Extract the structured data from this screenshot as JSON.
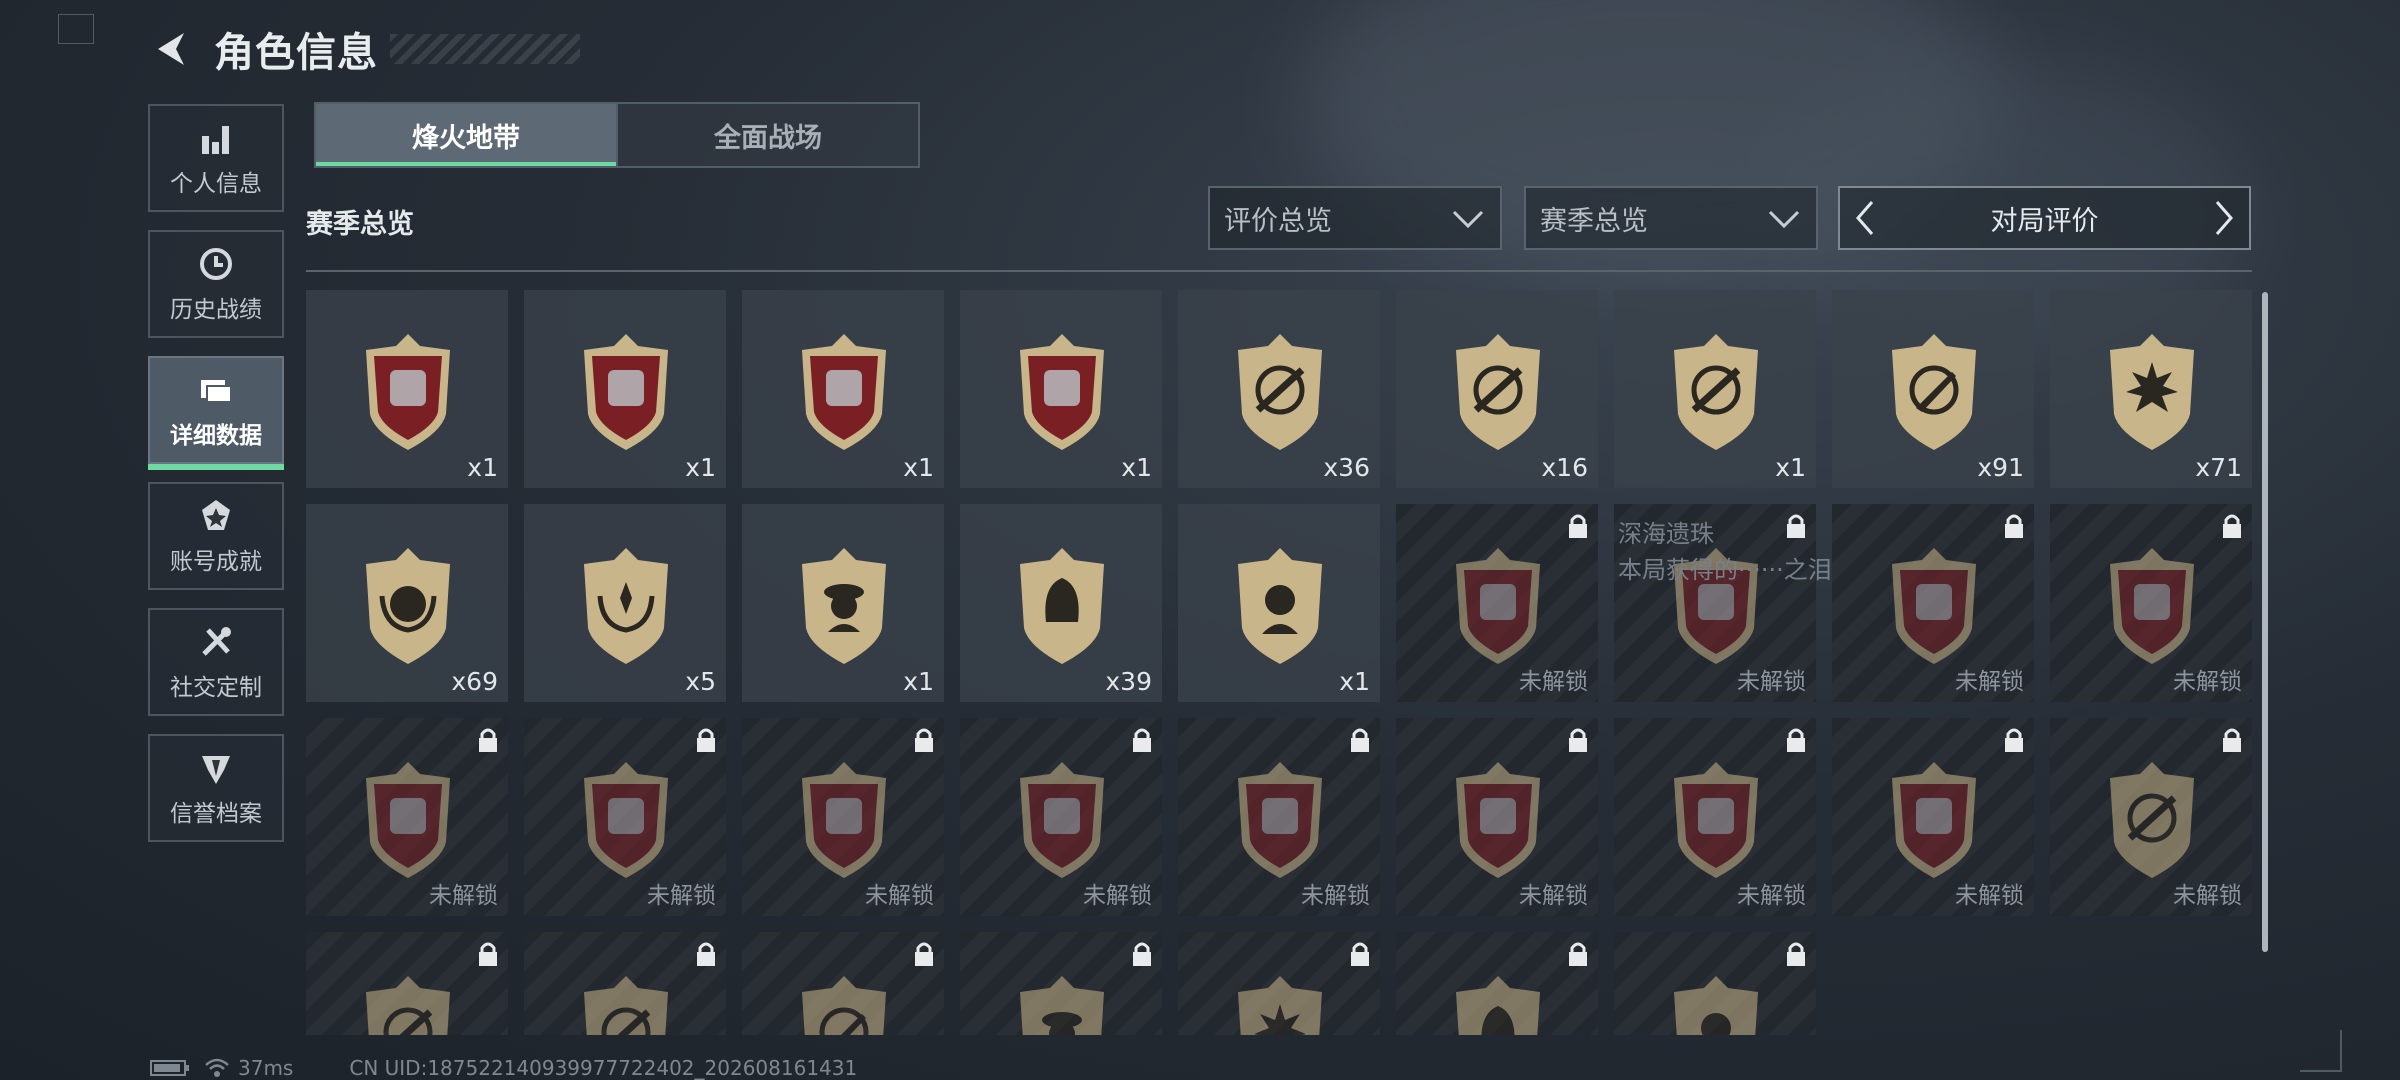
{
  "header": {
    "title": "角色信息"
  },
  "sidebar": {
    "items": [
      {
        "label": "个人信息",
        "icon": "bar-chart-icon"
      },
      {
        "label": "历史战绩",
        "icon": "clock-icon"
      },
      {
        "label": "详细数据",
        "icon": "folder-icon",
        "active": true
      },
      {
        "label": "账号成就",
        "icon": "achievement-icon"
      },
      {
        "label": "社交定制",
        "icon": "tools-icon"
      },
      {
        "label": "信誉档案",
        "icon": "shield-icon"
      }
    ]
  },
  "tabs": [
    {
      "label": "烽火地带",
      "active": true
    },
    {
      "label": "全面战场"
    }
  ],
  "section": {
    "title": "赛季总览",
    "dropdown1": "评价总览",
    "dropdown2": "赛季总览",
    "pager_label": "对局评价"
  },
  "cells": [
    {
      "icon": "diamond-icon",
      "count": "x1",
      "red": true
    },
    {
      "icon": "gold-bars-icon",
      "count": "x1",
      "red": true
    },
    {
      "icon": "book-icon",
      "count": "x1",
      "red": true
    },
    {
      "icon": "crystal-icon",
      "count": "x1",
      "red": true
    },
    {
      "icon": "crosshair-rifle-icon",
      "count": "x36"
    },
    {
      "icon": "crosshair-rifle-icon",
      "count": "x16"
    },
    {
      "icon": "crosshair-rifle-icon",
      "count": "x1"
    },
    {
      "icon": "crosshair-knife-icon",
      "count": "x91"
    },
    {
      "icon": "skull-burst-icon",
      "count": "x71"
    },
    {
      "icon": "wreath-emblem-icon",
      "count": "x69"
    },
    {
      "icon": "wreath-star-icon",
      "count": "x5"
    },
    {
      "icon": "soldier-icon",
      "count": "x1"
    },
    {
      "icon": "hooded-figure-icon",
      "count": "x39"
    },
    {
      "icon": "bald-figure-icon",
      "count": "x1"
    },
    {
      "icon": "pearl-icon",
      "count": "未解锁",
      "locked": true,
      "red": true
    },
    {
      "icon": "tank-icon",
      "count": "未解锁",
      "locked": true,
      "red": true
    },
    {
      "icon": "computer-icon",
      "count": "未解锁",
      "locked": true,
      "red": true
    },
    {
      "icon": "device-icon",
      "count": "未解锁",
      "locked": true,
      "red": true
    },
    {
      "icon": "plate-icon",
      "count": "未解锁",
      "locked": true,
      "red": true
    },
    {
      "icon": "machine-icon",
      "count": "未解锁",
      "locked": true,
      "red": true
    },
    {
      "icon": "lantern-icon",
      "count": "未解锁",
      "locked": true,
      "red": true
    },
    {
      "icon": "globe-icon",
      "count": "未解锁",
      "locked": true,
      "red": true
    },
    {
      "icon": "chessboard-icon",
      "count": "未解锁",
      "locked": true,
      "red": true
    },
    {
      "icon": "engine-icon",
      "count": "未解锁",
      "locked": true,
      "red": true
    },
    {
      "icon": "painting-icon",
      "count": "未解锁",
      "locked": true,
      "red": true
    },
    {
      "icon": "canister-icon",
      "count": "未解锁",
      "locked": true,
      "red": true
    },
    {
      "icon": "crosshair-rifle-icon",
      "count": "未解锁",
      "locked": true
    },
    {
      "icon": "crosshair-rifle-icon",
      "count": "",
      "locked": true
    },
    {
      "icon": "crosshair-rifle-icon",
      "count": "",
      "locked": true
    },
    {
      "icon": "crosshair-knife-icon",
      "count": "",
      "locked": true
    },
    {
      "icon": "soldier-icon",
      "count": "",
      "locked": true
    },
    {
      "icon": "skull-burst-icon",
      "count": "",
      "locked": true
    },
    {
      "icon": "hooded-figure-icon",
      "count": "",
      "locked": true
    },
    {
      "icon": "bald-figure-icon",
      "count": "",
      "locked": true
    }
  ],
  "tooltip": {
    "line1": "深海遗珠",
    "line2": "本局获得的",
    "line3": "之泪"
  },
  "status": {
    "ping": "37ms",
    "uid": "CN UID:187522140939977722402_202608161431"
  },
  "colors": {
    "accent": "#6fd9a3",
    "badge_gold": "#c9b58a",
    "badge_red": "#7a2024"
  }
}
